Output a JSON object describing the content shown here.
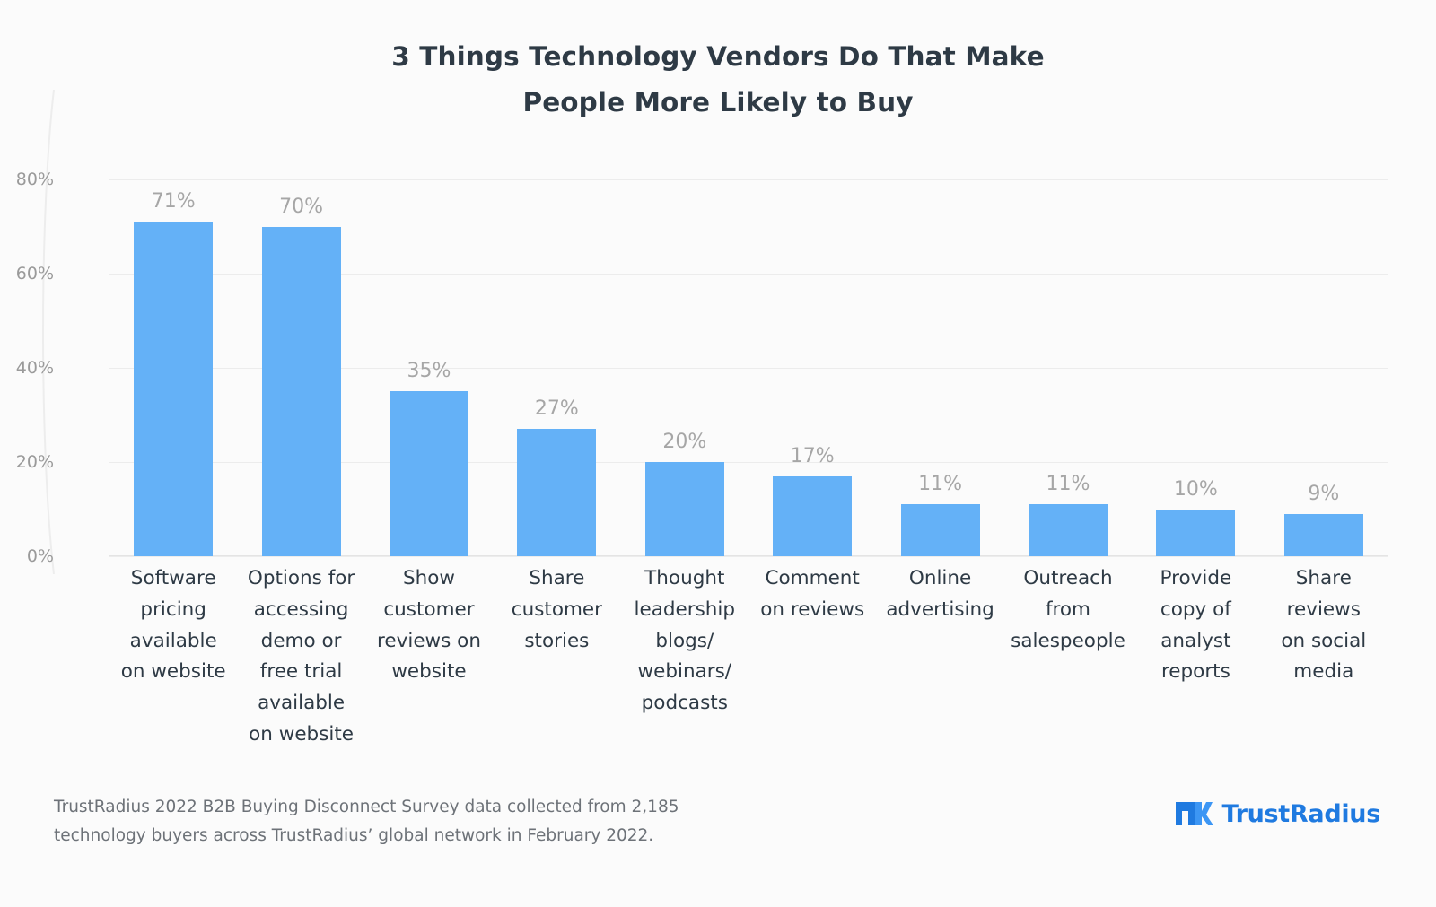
{
  "title_line1": "3 Things Technology Vendors Do That Make",
  "title_line2": "People More Likely to Buy",
  "footnote_line1": "TrustRadius 2022 B2B Buying Disconnect Survey data collected from 2,185",
  "footnote_line2": "technology buyers across TrustRadius’ global network in February 2022.",
  "logo": {
    "mark": "trustradius-logo-icon",
    "text_primary": "TrustRadius"
  },
  "colors": {
    "bar": "#64b1f7",
    "title": "#2e3a45",
    "axis_text": "#9a9a9a",
    "value_text": "#a6a6a6",
    "background": "#fbfbfb",
    "grid": "#ececec",
    "logo_blue": "#1f7ae0"
  },
  "chart_data": {
    "type": "bar",
    "title": "3 Things Technology Vendors Do That Make People More Likely to Buy",
    "subtitle": "",
    "xlabel": "",
    "ylabel": "",
    "ylim": [
      0,
      80
    ],
    "grid": true,
    "legend": "none",
    "ytick_labels": [
      "0%",
      "20%",
      "40%",
      "60%",
      "80%"
    ],
    "ytick_values": [
      0,
      20,
      40,
      60,
      80
    ],
    "categories": [
      "Software pricing available on website",
      "Options for accessing demo or free trial available on website",
      "Show customer reviews on website",
      "Share customer stories",
      "Thought leadership blogs/ webinars/ podcasts",
      "Comment on reviews",
      "Online advertising",
      "Outreach from salespeople",
      "Provide copy of analyst reports",
      "Share reviews on social media"
    ],
    "category_lines": [
      [
        "Software",
        "pricing",
        "available",
        "on website"
      ],
      [
        "Options for",
        "accessing",
        "demo or",
        "free trial",
        "available",
        "on website"
      ],
      [
        "Show",
        "customer",
        "reviews on",
        "website"
      ],
      [
        "Share",
        "customer",
        "stories"
      ],
      [
        "Thought",
        "leadership",
        "blogs/",
        "webinars/",
        "podcasts"
      ],
      [
        "Comment",
        "on reviews"
      ],
      [
        "Online",
        "advertising"
      ],
      [
        "Outreach",
        "from",
        "salespeople"
      ],
      [
        "Provide",
        "copy of",
        "analyst",
        "reports"
      ],
      [
        "Share",
        "reviews",
        "on social",
        "media"
      ]
    ],
    "values": [
      71,
      70,
      35,
      27,
      20,
      17,
      11,
      11,
      10,
      9
    ],
    "value_labels": [
      "71%",
      "70%",
      "35%",
      "27%",
      "20%",
      "17%",
      "11%",
      "11%",
      "10%",
      "9%"
    ]
  }
}
